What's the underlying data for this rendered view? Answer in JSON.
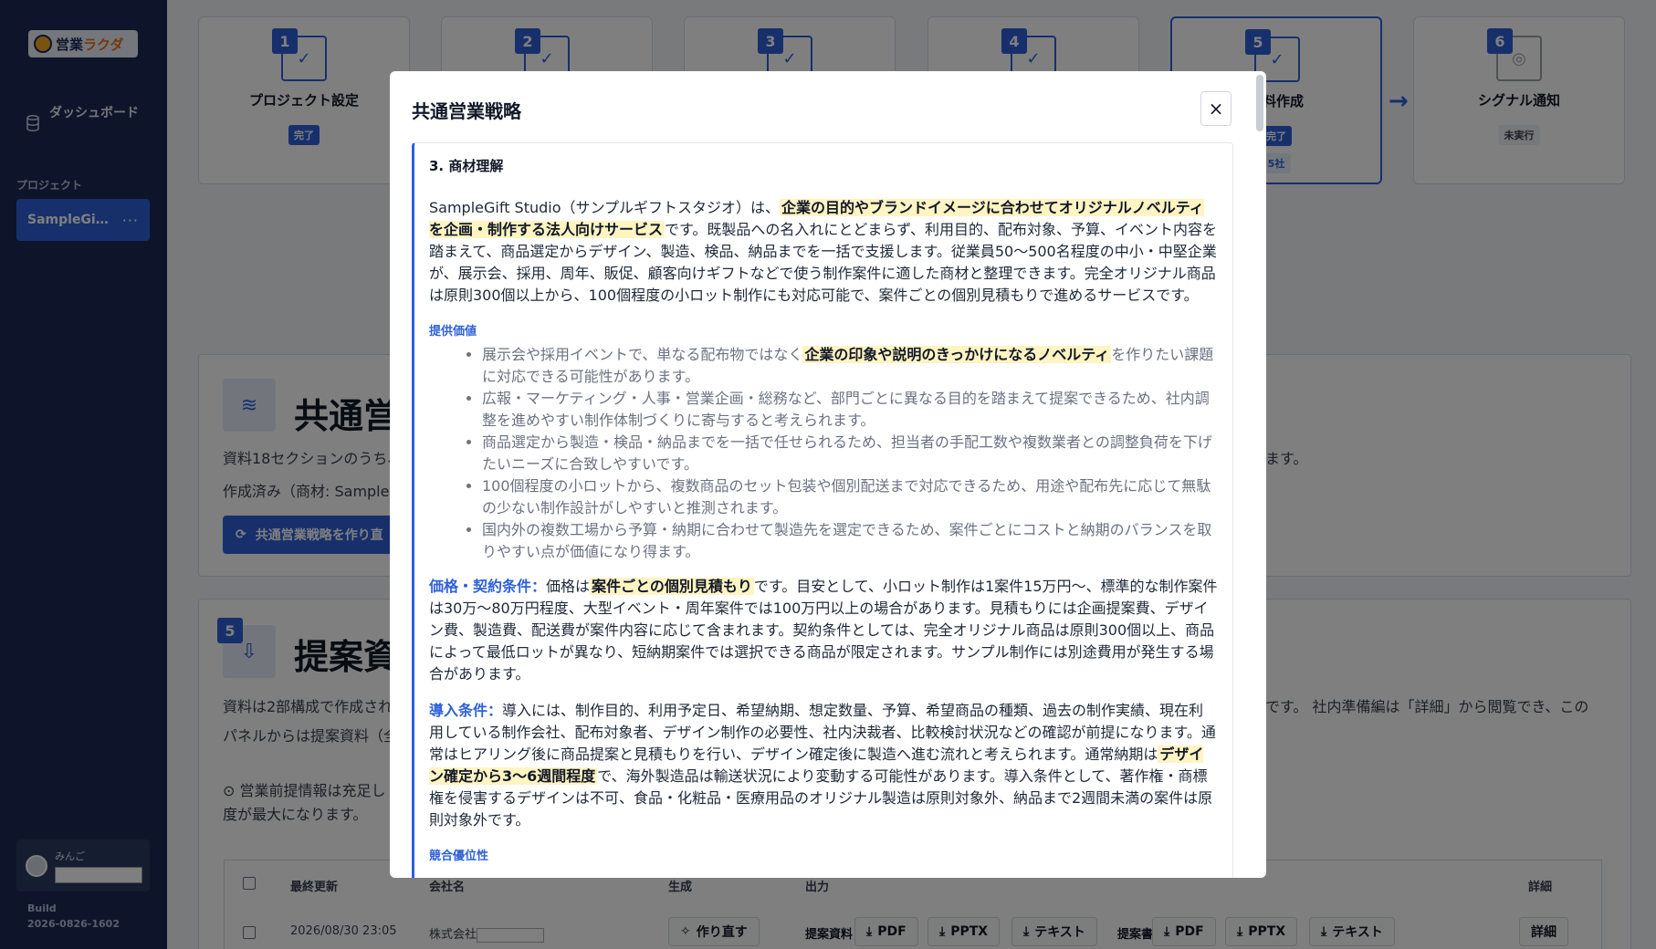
{
  "app": {
    "logo_text_a": "営業",
    "logo_text_b": "ラクダ"
  },
  "sidebar": {
    "dashboard_label": "ダッシュボード",
    "section_label": "プロジェクト",
    "project_name": "SampleGi…",
    "project_menu": "···",
    "user_name": "みんご",
    "build_label": "Build",
    "build_value": "2026-0826-1602"
  },
  "steps": [
    {
      "num": "1",
      "title": "プロジェクト設定",
      "badge": "完了"
    },
    {
      "num": "2",
      "title": "",
      "badge": ""
    },
    {
      "num": "3",
      "title": "",
      "badge": ""
    },
    {
      "num": "4",
      "title": "",
      "badge": ""
    },
    {
      "num": "5",
      "title": "資料作成",
      "badge": "完了",
      "sub": "5社"
    },
    {
      "num": "6",
      "title": "シグナル通知",
      "badge": "未実行"
    }
  ],
  "panel_strategy": {
    "title": "共通営",
    "text1": "資料18セクションのうち、",
    "text1_right": "ます。",
    "text2": "作成済み（商材: SampleG",
    "button": "共通営業戦略を作り直"
  },
  "panel_proposal": {
    "num": "5",
    "title": "提案資",
    "text1": "資料は2部構成で作成され",
    "text1_right": "です。 社内準備編は「詳細」から閲覧でき、この",
    "text2": "パネルからは提案資料（全",
    "text3": "営業前提情報は充足し",
    "text4": "度が最大になります。"
  },
  "table": {
    "headers": [
      "最終更新",
      "会社名",
      "生成",
      "出力",
      "詳細"
    ],
    "row": {
      "updated": "2026/08/30 23:05",
      "company_prefix": "株式会社",
      "regen": "作り直す",
      "label_deck": "提案資料",
      "label_doc": "提案書",
      "pdf": "PDF",
      "pptx": "PPTX",
      "text": "テキスト",
      "detail": "詳細"
    }
  },
  "modal": {
    "title": "共通営業戦略",
    "close_icon": "×",
    "section_title": "3. 商材理解",
    "p1_a": "SampleGift Studio（サンプルギフトスタジオ）は、",
    "p1_hl": "企業の目的やブランドイメージに合わせてオリジナルノベルティを企画・制作する法人向けサービス",
    "p1_b": "です。既製品への名入れにとどまらず、利用目的、配布対象、予算、イベント内容を踏まえて、商品選定からデザイン、製造、検品、納品までを一括で支援します。従業員50〜500名程度の中小・中堅企業が、展示会、採用、周年、販促、顧客向けギフトなどで使う制作案件に適した商材と整理できます。完全オリジナル商品は原則300個以上から、100個程度の小ロット制作にも対応可能で、案件ごとの個別見積もりで進めるサービスです。",
    "value_label": "提供価値",
    "b1_a": "展示会や採用イベントで、単なる配布物ではなく",
    "b1_hl": "企業の印象や説明のきっかけになるノベルティ",
    "b1_b": "を作りたい課題に対応できる可能性があります。",
    "b2": "広報・マーケティング・人事・営業企画・総務など、部門ごとに異なる目的を踏まえて提案できるため、社内調整を進めやすい制作体制づくりに寄与すると考えられます。",
    "b3": "商品選定から製造・検品・納品までを一括で任せられるため、担当者の手配工数や複数業者との調整負荷を下げたいニーズに合致しやすいです。",
    "b4": "100個程度の小ロットから、複数商品のセット包装や個別配送まで対応できるため、用途や配布先に応じて無駄の少ない制作設計がしやすいと推測されます。",
    "b5": "国内外の複数工場から予算・納期に合わせて製造先を選定できるため、案件ごとにコストと納期のバランスを取りやすい点が価値になり得ます。",
    "price_label": "価格・契約条件：",
    "price_a": "価格は",
    "price_hl": "案件ごとの個別見積もり",
    "price_b": "です。目安として、小ロット制作は1案件15万円〜、標準的な制作案件は30万〜80万円程度、大型イベント・周年案件では100万円以上の場合があります。見積もりには企画提案費、デザイン費、製造費、配送費が案件内容に応じて含まれます。契約条件としては、完全オリジナル商品は原則300個以上、商品によって最低ロットが異なり、短納期案件では選択できる商品が限定されます。サンプル制作には別途費用が発生する場合があります。",
    "intro_label": "導入条件：",
    "intro_a": "導入には、制作目的、利用予定日、希望納期、想定数量、予算、希望商品の種類、過去の制作実績、現在利用している制作会社、配布対象者、デザイン制作の必要性、社内決裁者、比較検討状況などの確認が前提になります。通常はヒアリング後に商品提案と見積もりを行い、デザイン確定後に製造へ進む流れと考えられます。通常納期は",
    "intro_hl": "デザイン確定から3〜6週間程度",
    "intro_b": "で、海外製造品は輸送状況により変動する可能性があります。導入条件として、著作権・商標権を侵害するデザインは不可、食品・化粧品・医療用品のオリジナル製造は原則対象外、納品まで2週間未満の案件は原則対象外です。",
    "competitive_label": "競合優位性"
  },
  "colors": {
    "sidebar_bg": "#1c2b57",
    "accent": "#2e61d8",
    "highlight": "#fff4c2"
  }
}
